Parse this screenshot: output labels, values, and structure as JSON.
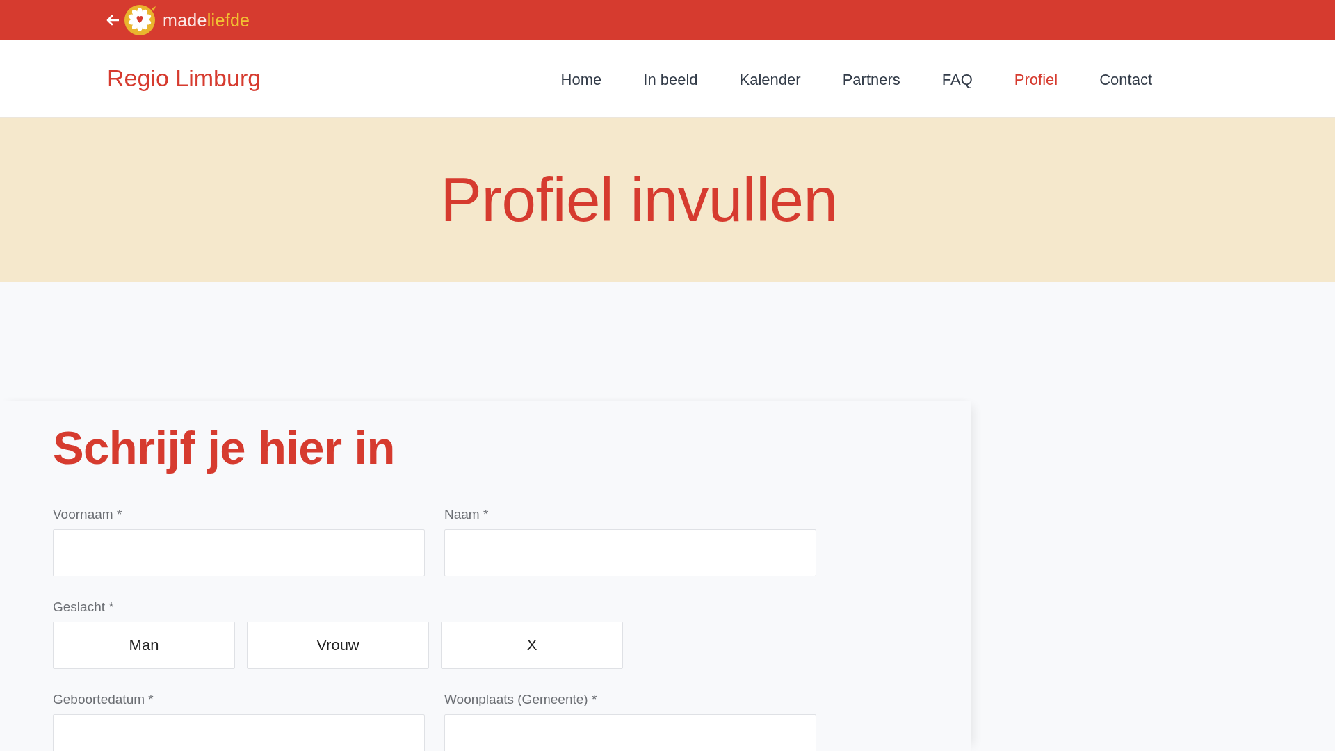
{
  "top_bar": {
    "brand": {
      "prefix": "made",
      "suffix": "liefde"
    }
  },
  "header": {
    "site_title": "Regio Limburg",
    "nav": [
      {
        "label": "Home",
        "selected": false
      },
      {
        "label": "In beeld",
        "selected": false
      },
      {
        "label": "Kalender",
        "selected": false
      },
      {
        "label": "Partners",
        "selected": false
      },
      {
        "label": "FAQ",
        "selected": false
      },
      {
        "label": "Profiel",
        "selected": true
      },
      {
        "label": "Contact",
        "selected": false
      }
    ]
  },
  "hero": {
    "title": "Profiel invullen"
  },
  "form": {
    "heading": "Schrijf je hier in",
    "fields": [
      {
        "kind": "text",
        "label": "Voornaam *"
      },
      {
        "kind": "text",
        "label": "Naam *"
      },
      {
        "kind": "choice",
        "label": "Geslacht *",
        "options": [
          {
            "label": "Man",
            "selected": false
          },
          {
            "label": "Vrouw",
            "selected": false
          },
          {
            "label": "X",
            "selected": false
          }
        ]
      },
      {
        "kind": "text",
        "label": "Geboortedatum *"
      },
      {
        "kind": "text",
        "label": "Woonplaats (Gemeente) *"
      }
    ]
  }
}
